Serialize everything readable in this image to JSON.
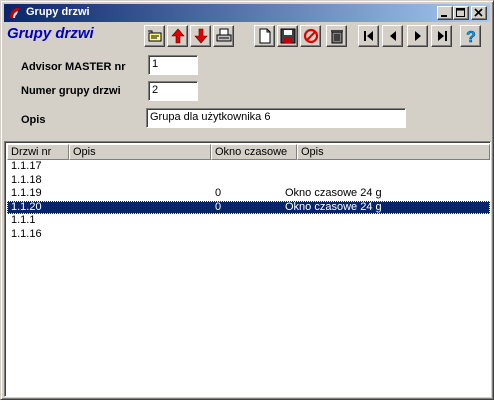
{
  "window": {
    "title": "Grupy drzwi",
    "controls": [
      "minimize-icon",
      "maximize-icon",
      "close-icon"
    ]
  },
  "header": {
    "title": "Grupy drzwi"
  },
  "toolbar": {
    "buttons": [
      {
        "name": "find-icon"
      },
      {
        "name": "arrow-up-icon"
      },
      {
        "name": "arrow-down-icon"
      },
      {
        "name": "print-icon"
      },
      {
        "name": "new-document-icon"
      },
      {
        "name": "save-icon"
      },
      {
        "name": "cancel-icon"
      },
      {
        "name": "trash-icon"
      },
      {
        "name": "first-record-icon"
      },
      {
        "name": "previous-record-icon"
      },
      {
        "name": "next-record-icon"
      },
      {
        "name": "last-record-icon"
      },
      {
        "name": "help-icon"
      }
    ]
  },
  "form": {
    "master_label": "Advisor MASTER nr",
    "master_value": "1",
    "group_label": "Numer grupy drzwi",
    "group_value": "2",
    "desc_label": "Opis",
    "desc_value": "Grupa dla użytkownika 6"
  },
  "table": {
    "columns": [
      "Drzwi nr",
      "Opis",
      "Okno czasowe",
      "Opis"
    ],
    "rows": [
      {
        "door": "1.1.17",
        "desc": "",
        "window": "",
        "window_desc": ""
      },
      {
        "door": "1.1.18",
        "desc": "",
        "window": "",
        "window_desc": ""
      },
      {
        "door": "1.1.19",
        "desc": "",
        "window": "0",
        "window_desc": "Okno czasowe 24 g"
      },
      {
        "door": "1.1.20",
        "desc": "",
        "window": "0",
        "window_desc": "Okno czasowe 24 g",
        "selected": true
      },
      {
        "door": "1.1.1",
        "desc": "",
        "window": "",
        "window_desc": ""
      },
      {
        "door": "1.1.16",
        "desc": "",
        "window": "",
        "window_desc": ""
      }
    ]
  },
  "colors": {
    "title_bar": "#0a246a",
    "header_text": "#0000c0",
    "selection": "#0a246a",
    "face": "#d4d0c8"
  }
}
